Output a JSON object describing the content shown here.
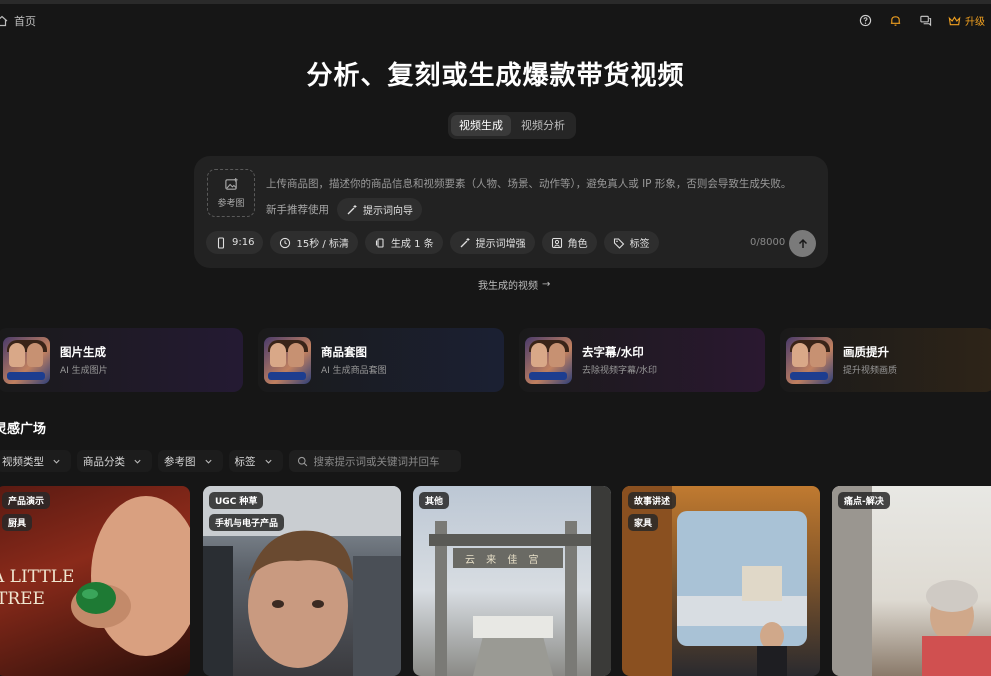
{
  "breadcrumb": {
    "home": "首页"
  },
  "topbar": {
    "help_icon": "question-circle-icon",
    "notify_icon": "bell-icon",
    "chat_icon": "chat-icon",
    "upgrade_label": "升级",
    "accent": "#f0a020"
  },
  "headline": "分析、复刻或生成爆款带货视频",
  "mode_tabs": [
    {
      "label": "视频生成",
      "active": true
    },
    {
      "label": "视频分析",
      "active": false
    }
  ],
  "composer": {
    "reference_label": "参考图",
    "placeholder": "上传商品图，描述你的商品信息和视频要素（人物、场景、动作等），避免真人或 IP 形象，否则会导致生成失败。",
    "recommend_label": "新手推荐使用",
    "prompt_wizard": "提示词向导",
    "options": {
      "ratio": "9:16",
      "duration": "15秒 / 标清",
      "count": "生成 1 条",
      "enhance": "提示词增强",
      "role": "角色",
      "tags": "标签"
    },
    "counter": "0/8000"
  },
  "my_videos_link": "我生成的视频",
  "features": [
    {
      "title": "图片生成",
      "subtitle": "AI 生成图片",
      "tint": "#241a33"
    },
    {
      "title": "商品套图",
      "subtitle": "AI 生成商品套图",
      "tint": "#1b2033"
    },
    {
      "title": "去字幕/水印",
      "subtitle": "去除视频字幕/水印",
      "tint": "#2a1830"
    },
    {
      "title": "画质提升",
      "subtitle": "提升视频画质",
      "tint": "#2e2418"
    }
  ],
  "inspiration": {
    "title": "灵感广场",
    "filters": [
      "视频类型",
      "商品分类",
      "参考图",
      "标签"
    ],
    "search_placeholder": "搜索提示词或关键词并回车"
  },
  "cards": [
    {
      "tags": [
        "产品演示",
        "厨具"
      ],
      "caption_lines": [
        "A LITTLE",
        "TREE"
      ]
    },
    {
      "tags": [
        "UGC 种草",
        "手机与电子产品"
      ]
    },
    {
      "tags": [
        "其他"
      ],
      "sign": "云 来 佳 宫"
    },
    {
      "tags": [
        "故事讲述",
        "家具"
      ]
    },
    {
      "tags": [
        "痛点-解决"
      ]
    }
  ]
}
